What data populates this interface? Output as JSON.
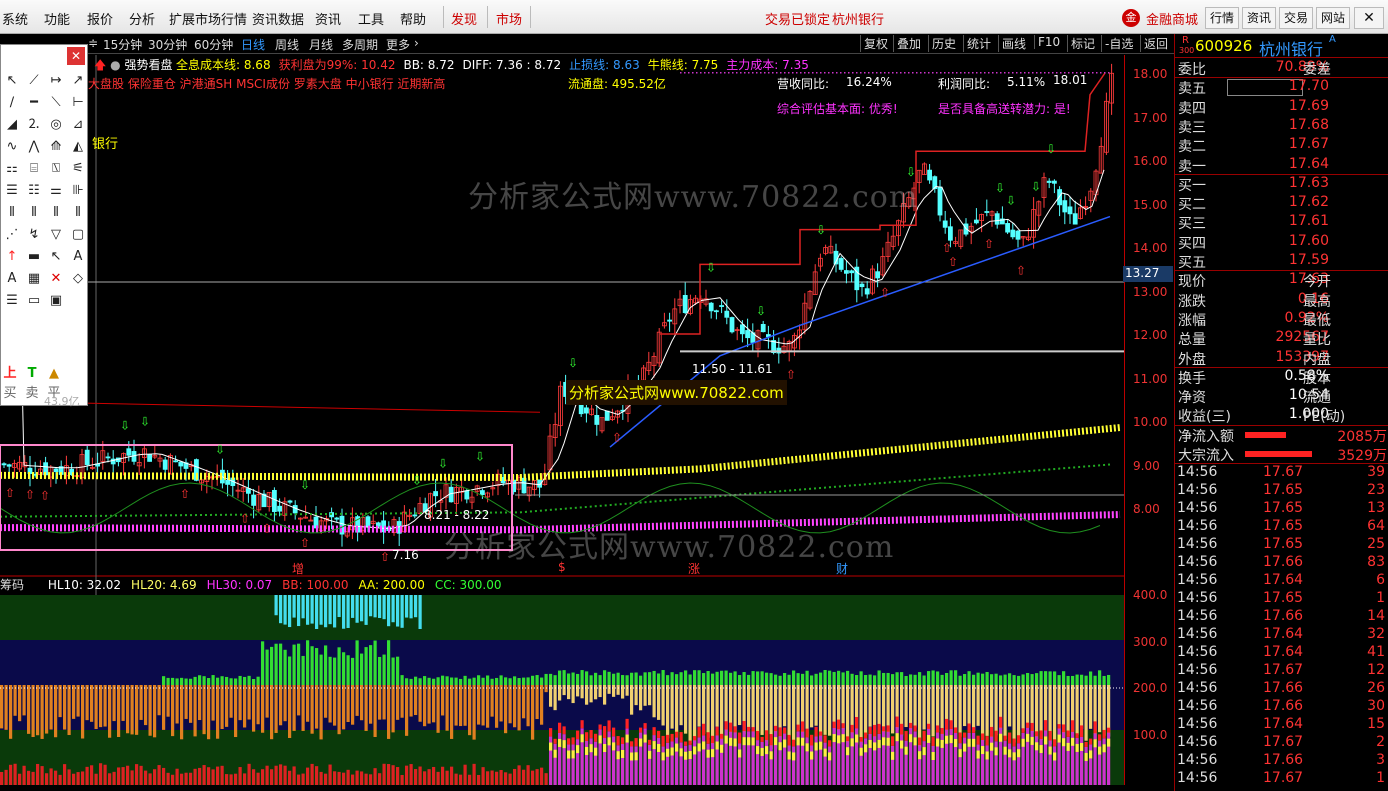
{
  "menu": {
    "items": [
      "系统",
      "功能",
      "报价",
      "分析",
      "扩展市场行情",
      "资讯数据",
      "资讯",
      "工具",
      "帮助",
      "发现",
      "市场"
    ],
    "center": "交易已锁定",
    "center_stock": "杭州银行",
    "right": [
      "金融商城",
      "行情",
      "资讯",
      "交易",
      "网站"
    ]
  },
  "toolbar": {
    "periods": [
      "15分钟",
      "30分钟",
      "60分钟",
      "日线",
      "周线",
      "月线",
      "多周期",
      "更多"
    ],
    "active": "日线",
    "right": [
      "复权",
      "叠加",
      "历史",
      "统计",
      "画线",
      "F10",
      "标记",
      "-自选",
      "返回"
    ],
    "active_right": "画线"
  },
  "indicator_line": {
    "name": "强势看盘",
    "items": [
      {
        "label": "全息成本线: 8.68",
        "color": "#ffff00"
      },
      {
        "label": "获利盘为99%: 10.42",
        "color": "#ff3333"
      },
      {
        "label": "BB: 8.72",
        "color": "#ffffff"
      },
      {
        "label": "DIFF: 7.36 : 8.72",
        "color": "#ffffff"
      },
      {
        "label": "止损线: 8.63",
        "color": "#3399ff"
      },
      {
        "label": "牛熊线: 7.75",
        "color": "#ffff00"
      },
      {
        "label": "主力成本: 7.35",
        "color": "#ff33ff"
      }
    ]
  },
  "tags": "大盘股 保险重仓 沪港通SH MSCI成份 罗素大盘 中小银行 近期新高",
  "stock_tag": "银行",
  "float_cap": "流通盘: 495.52亿",
  "revenue": {
    "label": "营收同比:",
    "value": "16.24%"
  },
  "profit": {
    "label": "利润同比:",
    "value": "5.11%"
  },
  "assess": "综合评估基本面: 优秀!",
  "potential": "是否具备高送转潜力: 是!",
  "price_max": "18.01",
  "ranges": [
    "11.50 - 11.61",
    "8.21 - 8.22",
    "7.16"
  ],
  "events": [
    "增",
    "$",
    "涨",
    "财"
  ],
  "watermark1": "分析家公式网www.70822.com",
  "watermark2": "分析家公式网www.70822.com",
  "watermark3": "分析家公式网www.70822.com",
  "cursor_price": "13.27",
  "price_axis": [
    "18.00",
    "17.00",
    "16.00",
    "15.00",
    "14.00",
    "13.00",
    "12.00",
    "11.00",
    "10.00",
    "9.00",
    "8.00"
  ],
  "sub_axis": [
    "400.0",
    "300.0",
    "200.0",
    "100.0"
  ],
  "sub_indicator": {
    "name": "筹码",
    "items": [
      {
        "label": "HL10: 32.02",
        "color": "#ffffff"
      },
      {
        "label": "HL20: 4.69",
        "color": "#ffff66"
      },
      {
        "label": "HL30: 0.07",
        "color": "#ff33ff"
      },
      {
        "label": "BB: 100.00",
        "color": "#ff3333"
      },
      {
        "label": "AA: 200.00",
        "color": "#ffff00"
      },
      {
        "label": "CC: 300.00",
        "color": "#33ff33"
      }
    ]
  },
  "toolbox": {
    "bottom": [
      "买",
      "卖",
      "平"
    ],
    "footer": "43.9亿"
  },
  "stock": {
    "code": "600926",
    "name": "杭州银行",
    "badge": "R",
    "market": "300"
  },
  "order_book": {
    "weibi": {
      "k": "委比",
      "v": "70.89%",
      "k2": "委差"
    },
    "sell": [
      {
        "k": "卖五",
        "v": "17.70"
      },
      {
        "k": "卖四",
        "v": "17.69"
      },
      {
        "k": "卖三",
        "v": "17.68"
      },
      {
        "k": "卖二",
        "v": "17.67"
      },
      {
        "k": "卖一",
        "v": "17.64"
      }
    ],
    "buy": [
      {
        "k": "买一",
        "v": "17.63"
      },
      {
        "k": "买二",
        "v": "17.62"
      },
      {
        "k": "买三",
        "v": "17.61"
      },
      {
        "k": "买四",
        "v": "17.60"
      },
      {
        "k": "买五",
        "v": "17.59"
      }
    ]
  },
  "quote": [
    {
      "k": "现价",
      "v": "17.63",
      "k2": "今开"
    },
    {
      "k": "涨跌",
      "v": "0.16",
      "k2": "最高"
    },
    {
      "k": "涨幅",
      "v": "0.92%",
      "k2": "最低"
    },
    {
      "k": "总量",
      "v": "292567",
      "k2": "量比"
    },
    {
      "k": "外盘",
      "v": "153397",
      "k2": "内盘"
    }
  ],
  "quote2": [
    {
      "k": "换手",
      "v": "0.58%",
      "k2": "股本"
    },
    {
      "k": "净资",
      "v": "10.54",
      "k2": "流通"
    },
    {
      "k": "收益(三)",
      "v": "1.000",
      "k2": "PE(动)"
    }
  ],
  "flows": [
    {
      "k": "净流入额",
      "v": "2085万",
      "fill": 0.55
    },
    {
      "k": "大宗流入",
      "v": "3529万",
      "fill": 0.9
    }
  ],
  "ticks": [
    [
      "14:56",
      "17.67",
      "39"
    ],
    [
      "14:56",
      "17.65",
      "23"
    ],
    [
      "14:56",
      "17.65",
      "13"
    ],
    [
      "14:56",
      "17.65",
      "64"
    ],
    [
      "14:56",
      "17.65",
      "25"
    ],
    [
      "14:56",
      "17.66",
      "83"
    ],
    [
      "14:56",
      "17.64",
      "6"
    ],
    [
      "14:56",
      "17.65",
      "1"
    ],
    [
      "14:56",
      "17.66",
      "14"
    ],
    [
      "14:56",
      "17.64",
      "32"
    ],
    [
      "14:56",
      "17.64",
      "41"
    ],
    [
      "14:56",
      "17.67",
      "12"
    ],
    [
      "14:56",
      "17.66",
      "26"
    ],
    [
      "14:56",
      "17.66",
      "30"
    ],
    [
      "14:56",
      "17.64",
      "15"
    ],
    [
      "14:56",
      "17.67",
      "2"
    ],
    [
      "14:56",
      "17.66",
      "3"
    ],
    [
      "14:56",
      "17.67",
      "1"
    ]
  ]
}
